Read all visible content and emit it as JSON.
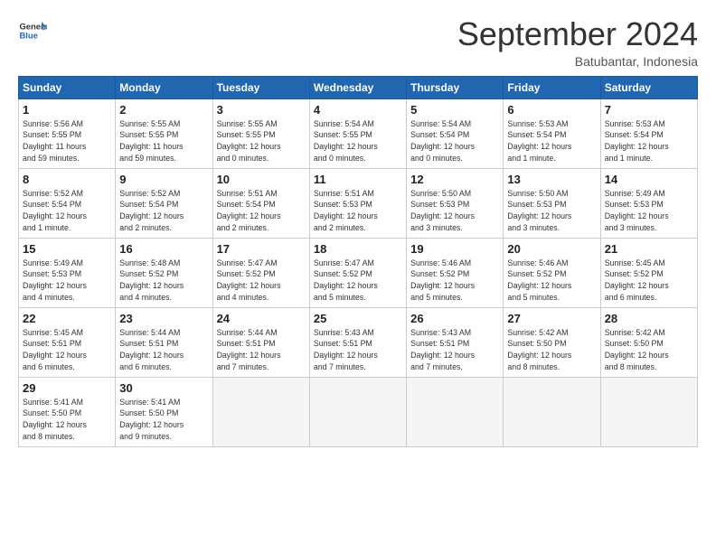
{
  "logo": {
    "line1": "General",
    "line2": "Blue"
  },
  "title": "September 2024",
  "subtitle": "Batubantar, Indonesia",
  "days_of_week": [
    "Sunday",
    "Monday",
    "Tuesday",
    "Wednesday",
    "Thursday",
    "Friday",
    "Saturday"
  ],
  "weeks": [
    [
      {
        "day": 1,
        "info": "Sunrise: 5:56 AM\nSunset: 5:55 PM\nDaylight: 11 hours\nand 59 minutes."
      },
      {
        "day": 2,
        "info": "Sunrise: 5:55 AM\nSunset: 5:55 PM\nDaylight: 11 hours\nand 59 minutes."
      },
      {
        "day": 3,
        "info": "Sunrise: 5:55 AM\nSunset: 5:55 PM\nDaylight: 12 hours\nand 0 minutes."
      },
      {
        "day": 4,
        "info": "Sunrise: 5:54 AM\nSunset: 5:55 PM\nDaylight: 12 hours\nand 0 minutes."
      },
      {
        "day": 5,
        "info": "Sunrise: 5:54 AM\nSunset: 5:54 PM\nDaylight: 12 hours\nand 0 minutes."
      },
      {
        "day": 6,
        "info": "Sunrise: 5:53 AM\nSunset: 5:54 PM\nDaylight: 12 hours\nand 1 minute."
      },
      {
        "day": 7,
        "info": "Sunrise: 5:53 AM\nSunset: 5:54 PM\nDaylight: 12 hours\nand 1 minute."
      }
    ],
    [
      {
        "day": 8,
        "info": "Sunrise: 5:52 AM\nSunset: 5:54 PM\nDaylight: 12 hours\nand 1 minute."
      },
      {
        "day": 9,
        "info": "Sunrise: 5:52 AM\nSunset: 5:54 PM\nDaylight: 12 hours\nand 2 minutes."
      },
      {
        "day": 10,
        "info": "Sunrise: 5:51 AM\nSunset: 5:54 PM\nDaylight: 12 hours\nand 2 minutes."
      },
      {
        "day": 11,
        "info": "Sunrise: 5:51 AM\nSunset: 5:53 PM\nDaylight: 12 hours\nand 2 minutes."
      },
      {
        "day": 12,
        "info": "Sunrise: 5:50 AM\nSunset: 5:53 PM\nDaylight: 12 hours\nand 3 minutes."
      },
      {
        "day": 13,
        "info": "Sunrise: 5:50 AM\nSunset: 5:53 PM\nDaylight: 12 hours\nand 3 minutes."
      },
      {
        "day": 14,
        "info": "Sunrise: 5:49 AM\nSunset: 5:53 PM\nDaylight: 12 hours\nand 3 minutes."
      }
    ],
    [
      {
        "day": 15,
        "info": "Sunrise: 5:49 AM\nSunset: 5:53 PM\nDaylight: 12 hours\nand 4 minutes."
      },
      {
        "day": 16,
        "info": "Sunrise: 5:48 AM\nSunset: 5:52 PM\nDaylight: 12 hours\nand 4 minutes."
      },
      {
        "day": 17,
        "info": "Sunrise: 5:47 AM\nSunset: 5:52 PM\nDaylight: 12 hours\nand 4 minutes."
      },
      {
        "day": 18,
        "info": "Sunrise: 5:47 AM\nSunset: 5:52 PM\nDaylight: 12 hours\nand 5 minutes."
      },
      {
        "day": 19,
        "info": "Sunrise: 5:46 AM\nSunset: 5:52 PM\nDaylight: 12 hours\nand 5 minutes."
      },
      {
        "day": 20,
        "info": "Sunrise: 5:46 AM\nSunset: 5:52 PM\nDaylight: 12 hours\nand 5 minutes."
      },
      {
        "day": 21,
        "info": "Sunrise: 5:45 AM\nSunset: 5:52 PM\nDaylight: 12 hours\nand 6 minutes."
      }
    ],
    [
      {
        "day": 22,
        "info": "Sunrise: 5:45 AM\nSunset: 5:51 PM\nDaylight: 12 hours\nand 6 minutes."
      },
      {
        "day": 23,
        "info": "Sunrise: 5:44 AM\nSunset: 5:51 PM\nDaylight: 12 hours\nand 6 minutes."
      },
      {
        "day": 24,
        "info": "Sunrise: 5:44 AM\nSunset: 5:51 PM\nDaylight: 12 hours\nand 7 minutes."
      },
      {
        "day": 25,
        "info": "Sunrise: 5:43 AM\nSunset: 5:51 PM\nDaylight: 12 hours\nand 7 minutes."
      },
      {
        "day": 26,
        "info": "Sunrise: 5:43 AM\nSunset: 5:51 PM\nDaylight: 12 hours\nand 7 minutes."
      },
      {
        "day": 27,
        "info": "Sunrise: 5:42 AM\nSunset: 5:50 PM\nDaylight: 12 hours\nand 8 minutes."
      },
      {
        "day": 28,
        "info": "Sunrise: 5:42 AM\nSunset: 5:50 PM\nDaylight: 12 hours\nand 8 minutes."
      }
    ],
    [
      {
        "day": 29,
        "info": "Sunrise: 5:41 AM\nSunset: 5:50 PM\nDaylight: 12 hours\nand 8 minutes."
      },
      {
        "day": 30,
        "info": "Sunrise: 5:41 AM\nSunset: 5:50 PM\nDaylight: 12 hours\nand 9 minutes."
      },
      null,
      null,
      null,
      null,
      null
    ]
  ]
}
